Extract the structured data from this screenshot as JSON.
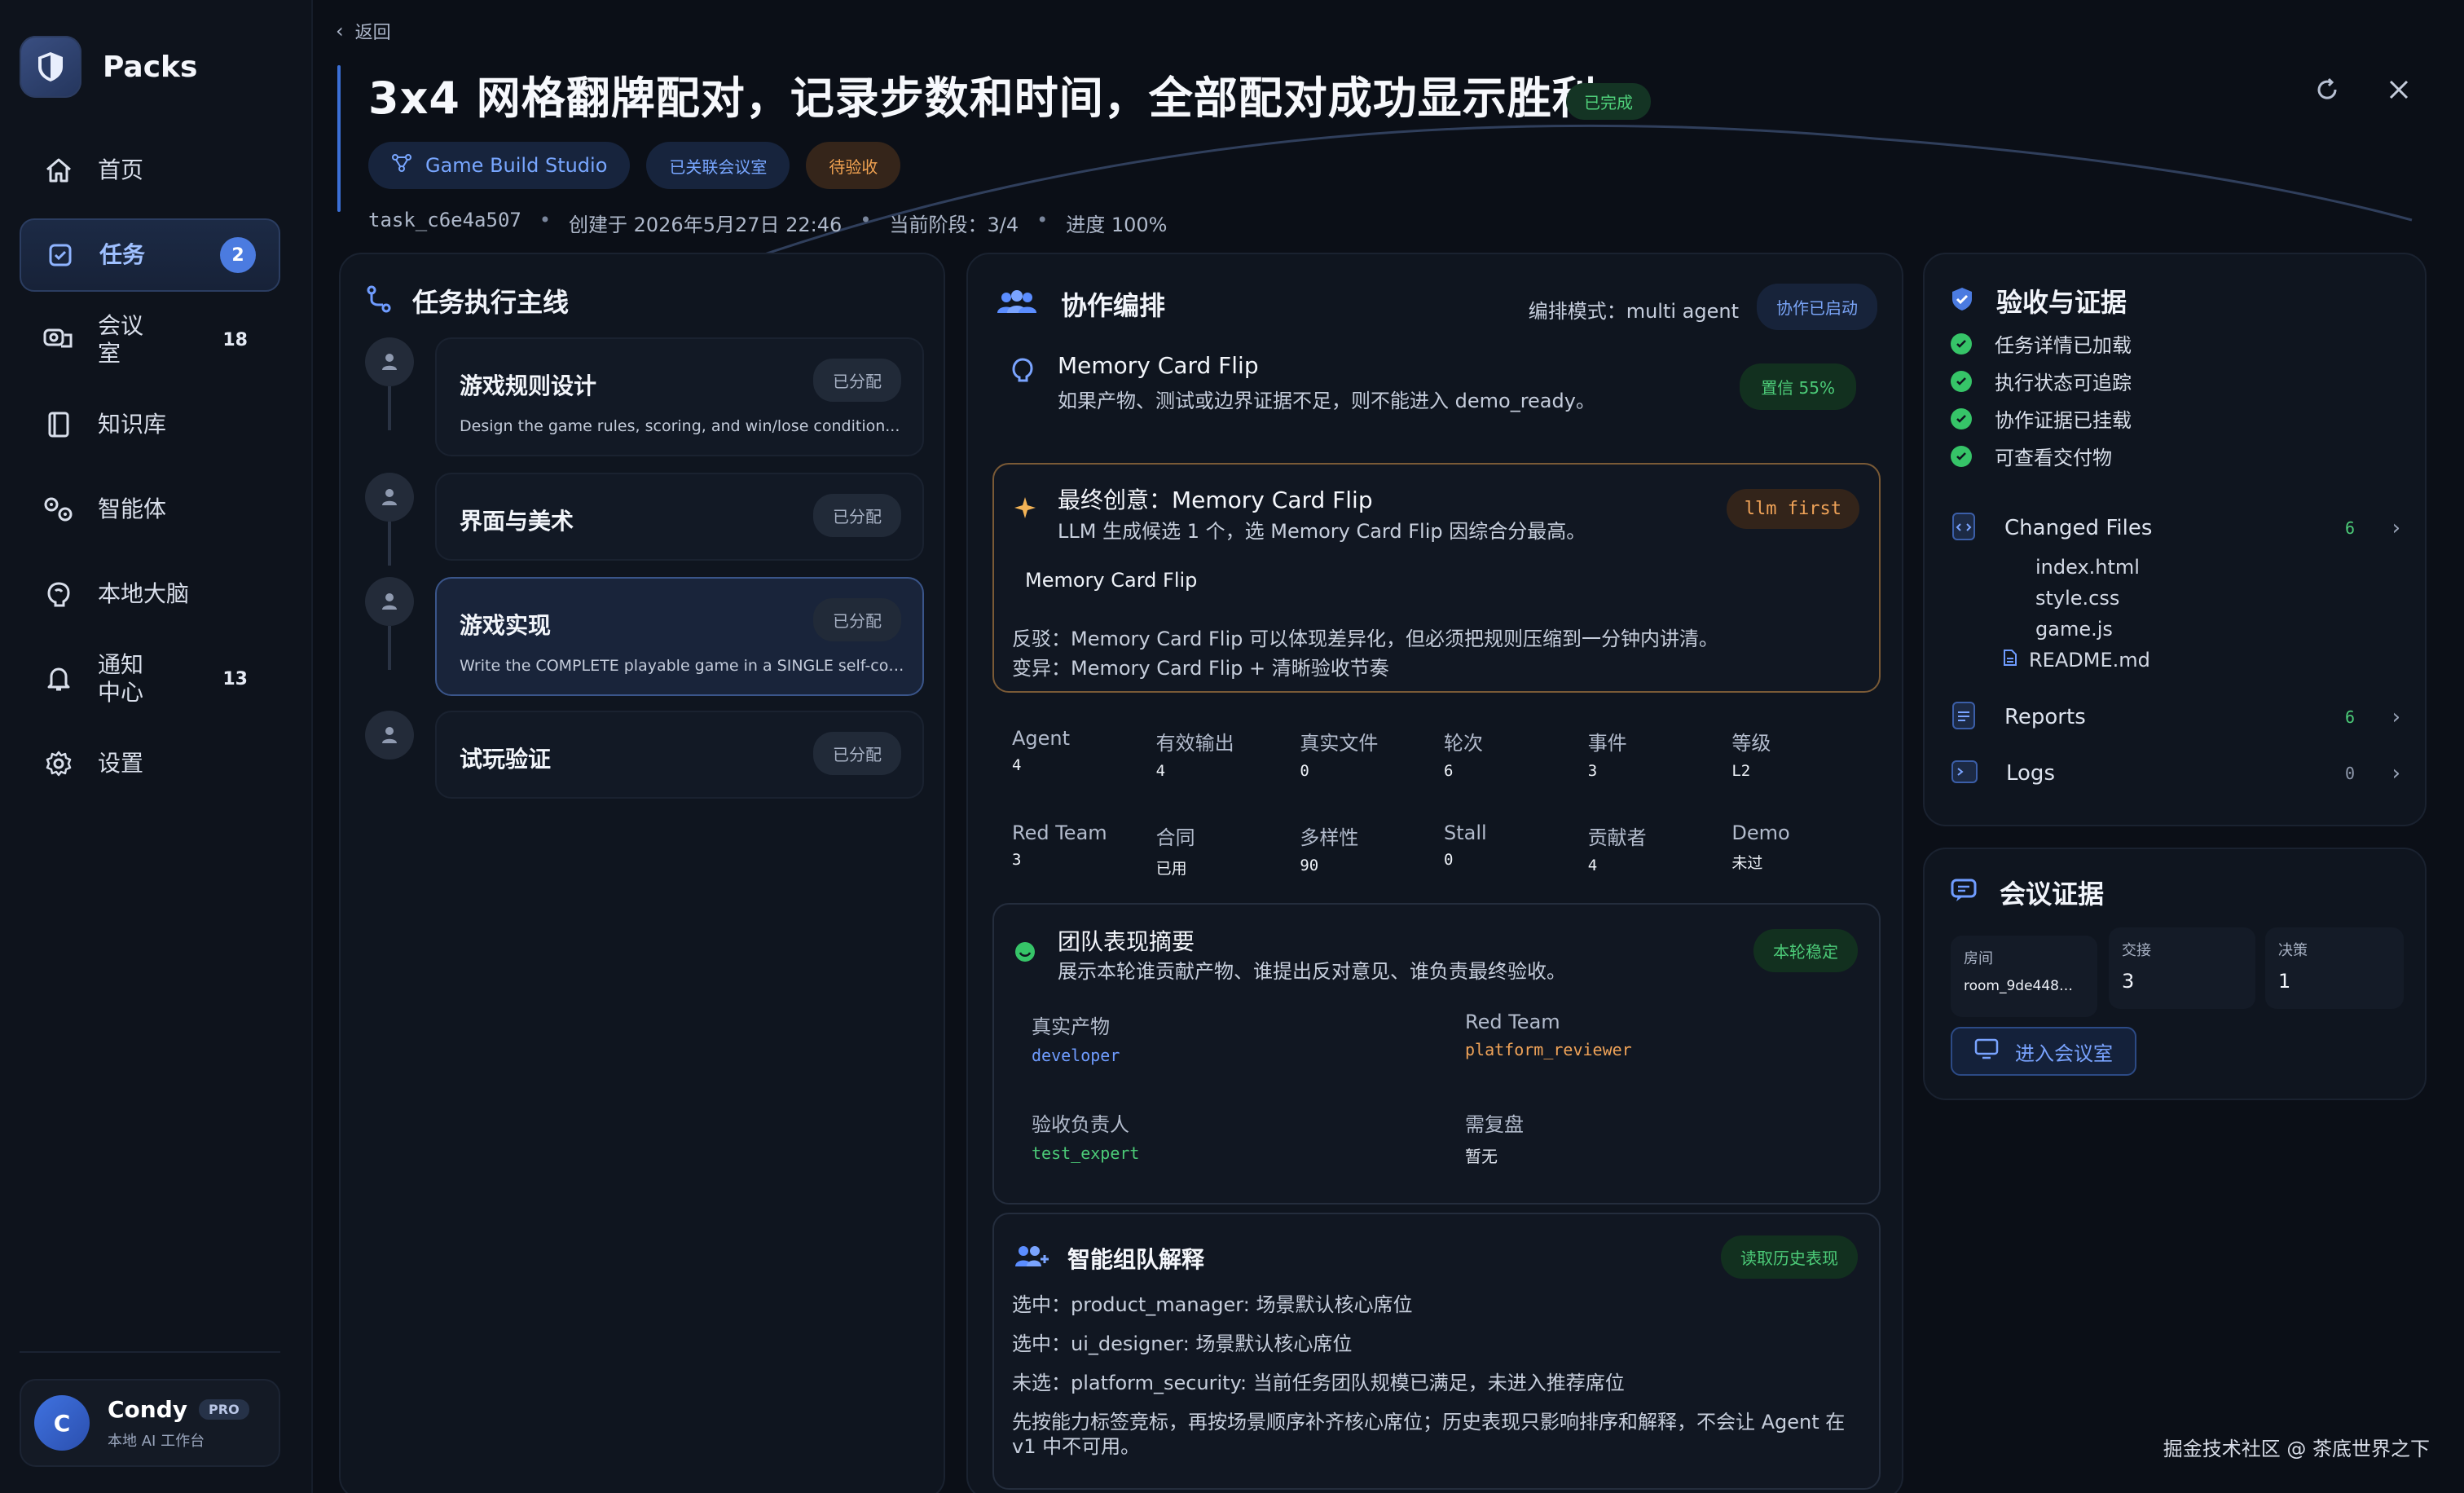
{
  "brand": {
    "name": "Packs"
  },
  "sidebar": {
    "items": [
      {
        "label": "首页",
        "icon": "home-icon",
        "count": ""
      },
      {
        "label": "任务",
        "icon": "checkbox-icon",
        "count": "2",
        "active": true
      },
      {
        "label": "会议\n室",
        "icon": "meeting-room-icon",
        "count": "18"
      },
      {
        "label": "知识库",
        "icon": "book-icon",
        "count": ""
      },
      {
        "label": "智能体",
        "icon": "agents-icon",
        "count": ""
      },
      {
        "label": "本地大脑",
        "icon": "brain-icon",
        "count": ""
      },
      {
        "label": "通知\n中心",
        "icon": "bell-icon",
        "count": "13"
      },
      {
        "label": "设置",
        "icon": "gear-icon",
        "count": ""
      }
    ],
    "user": {
      "initial": "C",
      "name": "Condy",
      "badge": "PRO",
      "subtitle": "本地 AI 工作台"
    }
  },
  "header": {
    "back_label": "返回",
    "title": "3x4 网格翻牌配对，记录步数和时间，全部配对成功显示胜利",
    "status": "已完成",
    "chips": [
      "Game Build Studio",
      "已关联会议室",
      "待验收"
    ],
    "meta": [
      "task_c6e4a507",
      "创建于 2026年5月27日 22:46",
      "当前阶段：3/4",
      "进度 100%"
    ]
  },
  "timeline": {
    "title": "任务执行主线",
    "steps": [
      {
        "name": "游戏规则设计",
        "badge": "已分配",
        "desc": "Design the game rules, scoring, and win/lose condition..."
      },
      {
        "name": "界面与美术",
        "badge": "已分配",
        "desc": ""
      },
      {
        "name": "游戏实现",
        "badge": "已分配",
        "desc": "Write the COMPLETE playable game in a SINGLE self-cont..."
      },
      {
        "name": "试玩验证",
        "badge": "已分配",
        "desc": ""
      }
    ]
  },
  "collab": {
    "title": "协作编排",
    "mode_label": "编排模式：multi agent",
    "status_badge": "协作已启动",
    "idea": {
      "title": "Memory Card Flip",
      "sub": "如果产物、测试或边界证据不足，则不能进入 demo_ready。",
      "confidence": "置信 55%"
    },
    "final": {
      "title": "最终创意：Memory Card Flip",
      "sub": "LLM 生成候选 1 个，选 Memory Card Flip 因综合分最高。",
      "badge": "llm first",
      "name": "Memory Card Flip",
      "rebuttal": "反驳：Memory Card Flip 可以体现差异化，但必须把规则压缩到一分钟内讲清。",
      "variant": "变异：Memory Card Flip + 清晰验收节奏"
    },
    "stats_row1": [
      {
        "label": "Agent",
        "value": "4"
      },
      {
        "label": "有效输出",
        "value": "4"
      },
      {
        "label": "真实文件",
        "value": "0"
      },
      {
        "label": "轮次",
        "value": "6"
      },
      {
        "label": "事件",
        "value": "3"
      },
      {
        "label": "等级",
        "value": "L2"
      }
    ],
    "stats_row2": [
      {
        "label": "Red Team",
        "value": "3"
      },
      {
        "label": "合同",
        "value": "已用"
      },
      {
        "label": "多样性",
        "value": "90"
      },
      {
        "label": "Stall",
        "value": "0"
      },
      {
        "label": "贡献者",
        "value": "4"
      },
      {
        "label": "Demo",
        "value": "未过"
      }
    ],
    "team": {
      "title": "团队表现摘要",
      "sub": "展示本轮谁贡献产物、谁提出反对意见、谁负责最终验收。",
      "badge": "本轮稳定",
      "artifacts_label": "真实产物",
      "artifacts_value": "developer",
      "redteam_label": "Red Team",
      "redteam_value": "platform_reviewer",
      "owner_label": "验收负责人",
      "owner_value": "test_expert",
      "review_label": "需复盘",
      "review_value": "暂无"
    },
    "explain": {
      "title": "智能组队解释",
      "badge": "读取历史表现",
      "lines": [
        "选中：product_manager: 场景默认核心席位",
        "选中：ui_designer: 场景默认核心席位",
        "未选：platform_security: 当前任务团队规模已满足，未进入推荐席位",
        "先按能力标签竞标，再按场景顺序补齐核心席位；历史表现只影响排序和解释，不会让 Agent 在 v1 中不可用。"
      ]
    }
  },
  "acceptance": {
    "title": "验收与证据",
    "checks": [
      "任务详情已加载",
      "执行状态可追踪",
      "协作证据已挂载",
      "可查看交付物"
    ],
    "changed_files": {
      "label": "Changed Files",
      "count": "6",
      "files": [
        "index.html",
        "style.css",
        "game.js",
        "README.md"
      ]
    },
    "reports": {
      "label": "Reports",
      "count": "6"
    },
    "logs": {
      "label": "Logs",
      "count": "0"
    }
  },
  "meeting": {
    "title": "会议证据",
    "room_label": "房间",
    "room_value": "room_9de448…",
    "handoff_label": "交接",
    "handoff_value": "3",
    "decision_label": "决策",
    "decision_value": "1",
    "enter_label": "进入会议室"
  },
  "watermark": "掘金技术社区 @ 茶底世界之下",
  "colors": {
    "accent": "#4b7be0",
    "success": "#4ccb78",
    "warning": "#f0a358",
    "background": "#0b0f17"
  }
}
